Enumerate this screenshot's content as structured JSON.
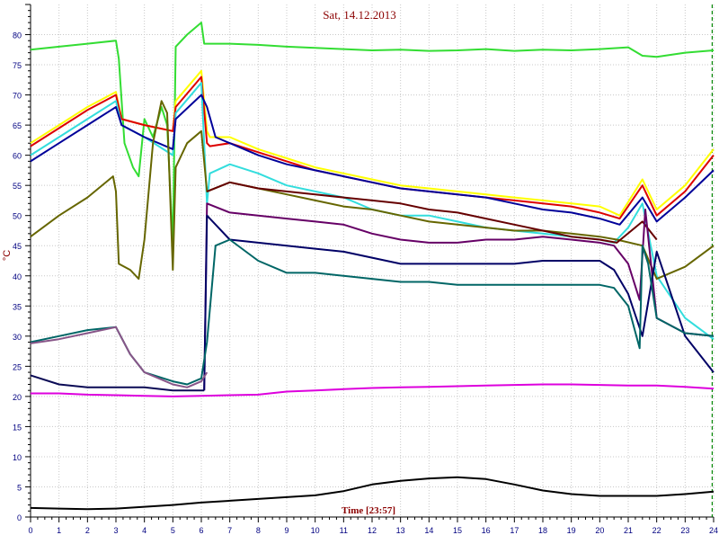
{
  "chart_data": {
    "type": "line",
    "title": "Sat, 14.12.2013",
    "xlabel": "Time [23:57]",
    "ylabel": "°C",
    "xlim": [
      0,
      24
    ],
    "ylim": [
      0,
      85
    ],
    "grid": true,
    "x_ticks": [
      0,
      1,
      2,
      3,
      4,
      5,
      6,
      7,
      8,
      9,
      10,
      11,
      12,
      13,
      14,
      15,
      16,
      17,
      18,
      19,
      20,
      21,
      22,
      23,
      24
    ],
    "y_ticks": [
      0,
      5,
      10,
      15,
      20,
      25,
      30,
      35,
      40,
      45,
      50,
      55,
      60,
      65,
      70,
      75,
      80
    ],
    "current_time_marker": 23.95,
    "series": [
      {
        "color": "#33dd33",
        "x": [
          0,
          1,
          2,
          3,
          3.1,
          3.3,
          3.6,
          3.8,
          4,
          4.3,
          4.6,
          4.8,
          5,
          5.1,
          5.5,
          6,
          6.1,
          6.2,
          7,
          8,
          9,
          10,
          11,
          12,
          13,
          14,
          15,
          16,
          17,
          18,
          19,
          20,
          21,
          21.5,
          22,
          23,
          24
        ],
        "y": [
          77.5,
          78,
          78.5,
          79,
          76,
          62,
          58,
          56.5,
          66,
          63,
          68,
          65,
          45,
          78,
          80,
          82,
          78.5,
          78.5,
          78.5,
          78.3,
          78,
          77.8,
          77.6,
          77.4,
          77.5,
          77.3,
          77.4,
          77.6,
          77.3,
          77.5,
          77.4,
          77.6,
          77.9,
          76.5,
          76.3,
          77,
          77.4
        ]
      },
      {
        "color": "#ffff00",
        "x": [
          0,
          1,
          2,
          3,
          3.2,
          4,
          5,
          5.1,
          6,
          6.2,
          6.3,
          7,
          8,
          9,
          10,
          11,
          12,
          13,
          14,
          15,
          16,
          17,
          18,
          19,
          20,
          20.7,
          21.5,
          22,
          23,
          24
        ],
        "y": [
          62,
          65,
          68,
          70.5,
          66,
          65,
          64,
          69,
          74,
          64,
          63,
          63,
          61,
          59.5,
          58,
          57,
          56,
          55,
          54.5,
          54,
          53.5,
          53,
          52.5,
          52,
          51.5,
          50,
          56,
          51,
          55,
          61
        ]
      },
      {
        "color": "#dd0000",
        "x": [
          0,
          1,
          2,
          3,
          3.2,
          4,
          5,
          5.1,
          6,
          6.2,
          6.3,
          7,
          8,
          9,
          10,
          11,
          12,
          13,
          14,
          15,
          16,
          17,
          18,
          19,
          20,
          20.7,
          21.5,
          22,
          23,
          24
        ],
        "y": [
          61.5,
          64.5,
          67.5,
          70,
          66,
          65,
          64,
          68,
          73,
          62,
          61.5,
          62,
          60.5,
          59,
          57.5,
          56.5,
          55.5,
          54.5,
          54,
          53.5,
          53,
          52.5,
          52,
          51.5,
          50.5,
          49.5,
          55,
          50,
          54,
          60
        ]
      },
      {
        "color": "#33dddd",
        "x": [
          0,
          1,
          2,
          3,
          3.2,
          4,
          5,
          5.1,
          6,
          6.2,
          6.3,
          7,
          8,
          9,
          10,
          11,
          12,
          13,
          14,
          15,
          16,
          17,
          18,
          19,
          20,
          20.5,
          21,
          21.5,
          22,
          23,
          24
        ],
        "y": [
          60,
          63,
          66,
          69,
          65,
          63,
          60,
          67,
          72,
          52,
          57,
          58.5,
          57,
          55,
          54,
          53,
          51,
          50,
          50,
          49,
          48,
          47.5,
          47,
          46.5,
          46,
          45.5,
          48,
          52,
          40,
          33,
          29.5
        ]
      },
      {
        "color": "#000099",
        "x": [
          0,
          1,
          2,
          3,
          3.2,
          4,
          5,
          5.1,
          6,
          6.2,
          6.5,
          7,
          8,
          9,
          10,
          11,
          12,
          13,
          14,
          15,
          16,
          17,
          18,
          19,
          20,
          20.7,
          21.5,
          22,
          23,
          24
        ],
        "y": [
          59,
          62,
          65,
          68,
          65,
          63,
          61,
          66,
          70,
          68,
          63,
          62,
          60,
          58.5,
          57.5,
          56.5,
          55.5,
          54.5,
          54,
          53.5,
          53,
          52,
          51,
          50.5,
          49.5,
          48.5,
          53,
          49,
          53,
          57.5
        ]
      },
      {
        "color": "#666600",
        "x": [
          0,
          1,
          2,
          2.9,
          3,
          3.1,
          3.5,
          3.8,
          4,
          4.3,
          4.6,
          4.8,
          5,
          5.1,
          5.5,
          6,
          6.2,
          7,
          8,
          9,
          10,
          11,
          12,
          13,
          14,
          15,
          16,
          17,
          18,
          19,
          20,
          20.6,
          21.5,
          22,
          23,
          24
        ],
        "y": [
          46.5,
          50,
          53,
          56.5,
          54,
          42,
          41,
          39.5,
          46,
          62,
          69,
          67,
          41,
          58,
          62,
          64,
          54,
          55.5,
          54.5,
          53.5,
          52.5,
          51.5,
          51,
          50,
          49,
          48.5,
          48,
          47.5,
          47.5,
          47,
          46.5,
          46,
          45,
          39.5,
          41.5,
          45
        ]
      },
      {
        "color": "#660000",
        "x": [
          6.2,
          7,
          8,
          9,
          10,
          11,
          12,
          13,
          14,
          15,
          16,
          17,
          18,
          19,
          20,
          20.6,
          21.5,
          22
        ],
        "y": [
          54,
          55.5,
          54.5,
          54,
          53.5,
          53,
          52.5,
          52,
          51,
          50.5,
          49.5,
          48.5,
          47.5,
          46.5,
          46,
          45.5,
          49,
          46
        ]
      },
      {
        "color": "#660066",
        "x": [
          6.1,
          6.2,
          7,
          8,
          9,
          10,
          11,
          12,
          13,
          14,
          15,
          16,
          17,
          18,
          19,
          20,
          20.5,
          21,
          21.4,
          21.6,
          22,
          23,
          24
        ],
        "y": [
          21,
          52,
          50.5,
          50,
          49.5,
          49,
          48.5,
          47,
          46,
          45.5,
          45.5,
          46,
          46,
          46.5,
          46,
          45.5,
          45,
          42,
          36,
          51,
          33,
          30.5,
          30
        ]
      },
      {
        "color": "#000066",
        "x": [
          6.1,
          6.2,
          7,
          8,
          9,
          10,
          11,
          12,
          13,
          14,
          15,
          16,
          17,
          18,
          19,
          20,
          20.5,
          21,
          21.5,
          22,
          23,
          24
        ],
        "y": [
          21,
          50,
          46,
          45.5,
          45,
          44.5,
          44,
          43,
          42,
          42,
          42,
          42,
          42,
          42.5,
          42.5,
          42.5,
          41,
          37,
          30,
          44,
          30,
          24
        ]
      },
      {
        "color": "#006666",
        "x": [
          0,
          1,
          2,
          3,
          3.5,
          4,
          5,
          5.5,
          6,
          6.2,
          6.5,
          7,
          8,
          9,
          10,
          11,
          12,
          13,
          14,
          15,
          16,
          17,
          18,
          19,
          20,
          20.5,
          21,
          21.4,
          21.5,
          21.7,
          22,
          23,
          24
        ],
        "y": [
          29,
          30,
          31,
          31.5,
          27,
          24,
          22.5,
          22,
          23,
          29,
          45,
          46,
          42.5,
          40.5,
          40.5,
          40,
          39.5,
          39,
          39,
          38.5,
          38.5,
          38.5,
          38.5,
          38.5,
          38.5,
          38,
          35,
          28,
          45,
          42,
          33,
          30.5,
          30
        ]
      },
      {
        "color": "#885588",
        "x": [
          0,
          1,
          2,
          3,
          3.5,
          4,
          5,
          5.5,
          6,
          6.2
        ],
        "y": [
          28.8,
          29.5,
          30.5,
          31.5,
          27,
          24,
          22,
          21.5,
          22.5,
          24
        ]
      },
      {
        "color": "#0a0a55",
        "x": [
          0,
          1,
          2,
          3,
          4,
          5,
          5.5,
          6,
          6.1
        ],
        "y": [
          23.5,
          22,
          21.5,
          21.5,
          21.5,
          21,
          21,
          21,
          21
        ]
      },
      {
        "color": "#dd00dd",
        "x": [
          0,
          1,
          2,
          3,
          4,
          5,
          6,
          7,
          8,
          9,
          10,
          11,
          12,
          13,
          14,
          15,
          16,
          17,
          18,
          19,
          20,
          21,
          22,
          23,
          24
        ],
        "y": [
          20.5,
          20.5,
          20.3,
          20.2,
          20.1,
          20,
          20.1,
          20.2,
          20.3,
          20.8,
          21,
          21.2,
          21.4,
          21.5,
          21.6,
          21.7,
          21.8,
          21.9,
          22,
          22,
          21.9,
          21.8,
          21.8,
          21.6,
          21.3
        ]
      },
      {
        "color": "#000000",
        "x": [
          0,
          1,
          2,
          3,
          4,
          5,
          6,
          7,
          8,
          9,
          10,
          11,
          12,
          13,
          14,
          15,
          16,
          17,
          18,
          19,
          20,
          21,
          22,
          23,
          24
        ],
        "y": [
          1.5,
          1.4,
          1.3,
          1.4,
          1.7,
          2.0,
          2.4,
          2.7,
          3.0,
          3.3,
          3.6,
          4.3,
          5.4,
          6.0,
          6.4,
          6.6,
          6.3,
          5.4,
          4.4,
          3.8,
          3.5,
          3.5,
          3.5,
          3.8,
          4.2
        ]
      }
    ]
  }
}
